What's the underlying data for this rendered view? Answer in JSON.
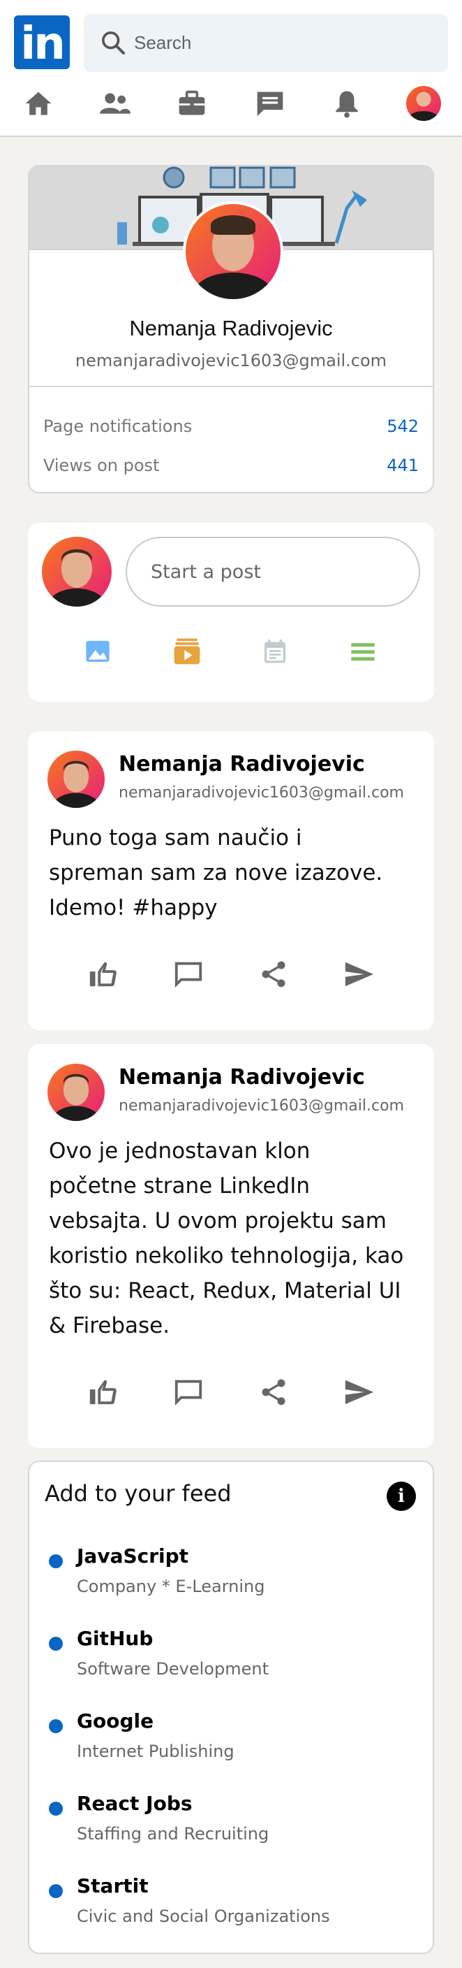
{
  "header": {
    "logo_text": "in",
    "search_placeholder": "Search",
    "nav_icons": [
      "home-icon",
      "network-icon",
      "jobs-icon",
      "messaging-icon",
      "notifications-icon",
      "me-avatar"
    ]
  },
  "profile": {
    "name": "Nemanja Radivojevic",
    "email": "nemanjaradivojevic1603@gmail.com",
    "stats": [
      {
        "label": "Page notifications",
        "value": "542"
      },
      {
        "label": "Views on post",
        "value": "441"
      }
    ]
  },
  "postbox": {
    "placeholder": "Start a post",
    "actions": [
      {
        "icon": "photo-icon",
        "color": "#70b5f9"
      },
      {
        "icon": "video-icon",
        "color": "#e7a33e"
      },
      {
        "icon": "event-icon",
        "color": "#c0cbcd"
      },
      {
        "icon": "article-icon",
        "color": "#7fc15e"
      }
    ]
  },
  "posts": [
    {
      "author": "Nemanja Radivojevic",
      "email": "nemanjaradivojevic1603@gmail.com",
      "text_lines": [
        "Puno toga sam naučio i",
        "spreman sam za nove izazove.",
        "Idemo! #happy"
      ]
    },
    {
      "author": "Nemanja Radivojevic",
      "email": "nemanjaradivojevic1603@gmail.com",
      "text_lines": [
        "Ovo je jednostavan klon",
        "početne strane LinkedIn",
        "vebsajta. U ovom projektu sam",
        "koristio nekoliko tehnologija, kao",
        "što su: React, Redux, Material UI",
        "& Firebase."
      ]
    }
  ],
  "feed": {
    "title": "Add to your feed",
    "items": [
      {
        "name": "JavaScript",
        "desc": "Company * E-Learning"
      },
      {
        "name": "GitHub",
        "desc": "Software Development"
      },
      {
        "name": "Google",
        "desc": "Internet Publishing"
      },
      {
        "name": "React Jobs",
        "desc": "Staffing and Recruiting"
      },
      {
        "name": "Startit",
        "desc": "Civic and Social Organizations"
      }
    ]
  },
  "colors": {
    "brand": "#0a66c2",
    "icon_gray": "#666666",
    "background": "#f3f2ef"
  }
}
